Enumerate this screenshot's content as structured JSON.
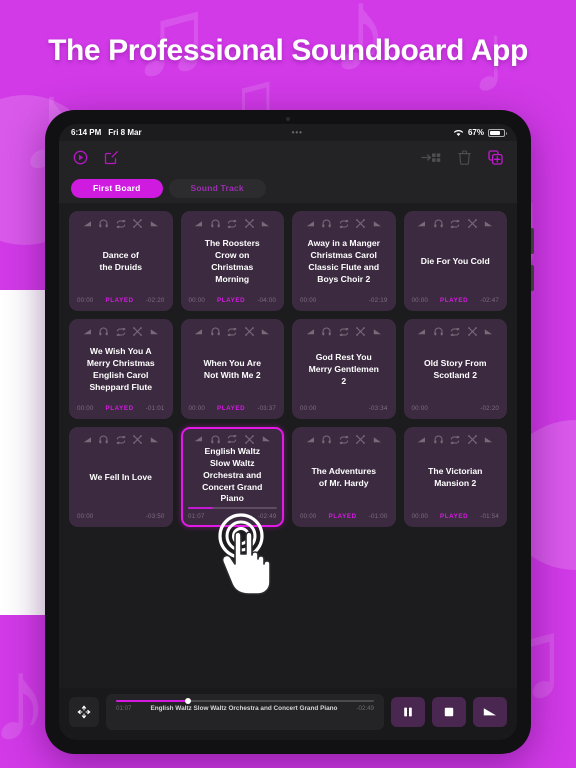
{
  "headline": "The Professional Soundboard App",
  "status_bar": {
    "time": "6:14 PM",
    "date": "Fri 8 Mar",
    "center_dots": "•••",
    "battery_percent": "67%",
    "wifi_icon": "wifi-icon",
    "battery_icon": "battery-icon"
  },
  "toolbar": {
    "left_icons": [
      {
        "name": "play-circle-icon"
      },
      {
        "name": "edit-square-icon"
      }
    ],
    "right_icons": [
      {
        "name": "move-to-grid-icon"
      },
      {
        "name": "trash-icon"
      },
      {
        "name": "duplicate-add-icon"
      }
    ]
  },
  "tabs": [
    {
      "label": "First Board",
      "active": true
    },
    {
      "label": "Sound Track",
      "active": false
    }
  ],
  "card_icons": [
    "fade-in-icon",
    "headphones-icon",
    "loop-icon",
    "effects-icon",
    "fade-out-icon"
  ],
  "cards": [
    {
      "title": "Dance of\nthe Druids",
      "elapsed": "00:00",
      "status": "PLAYED",
      "remaining": "-02:20",
      "selected": false,
      "progress": 0
    },
    {
      "title": "The Roosters\nCrow on\nChristmas\nMorning",
      "elapsed": "00:00",
      "status": "PLAYED",
      "remaining": "-04:00",
      "selected": false,
      "progress": 0
    },
    {
      "title": "Away in a Manger\nChristmas Carol\nClassic Flute and\nBoys Choir 2",
      "elapsed": "00:00",
      "status": "",
      "remaining": "-02:19",
      "selected": false,
      "progress": 0
    },
    {
      "title": "Die For You Cold",
      "elapsed": "00:00",
      "status": "PLAYED",
      "remaining": "-02:47",
      "selected": false,
      "progress": 0
    },
    {
      "title": "We Wish You A\nMerry Christmas\nEnglish Carol\nSheppard Flute",
      "elapsed": "00:00",
      "status": "PLAYED",
      "remaining": "-01:01",
      "selected": false,
      "progress": 0
    },
    {
      "title": "When You Are\nNot With Me 2",
      "elapsed": "00:00",
      "status": "PLAYED",
      "remaining": "-03:37",
      "selected": false,
      "progress": 0
    },
    {
      "title": "God Rest You\nMerry Gentlemen\n2",
      "elapsed": "00:00",
      "status": "",
      "remaining": "-03:34",
      "selected": false,
      "progress": 0
    },
    {
      "title": "Old Story From\nScotland 2",
      "elapsed": "00:00",
      "status": "",
      "remaining": "-02:20",
      "selected": false,
      "progress": 0
    },
    {
      "title": "We Fell In Love",
      "elapsed": "00:00",
      "status": "",
      "remaining": "-03:50",
      "selected": false,
      "progress": 0
    },
    {
      "title": "English Waltz\nSlow Waltz\nOrchestra and\nConcert Grand\nPiano",
      "elapsed": "01:07",
      "status": "",
      "remaining": "-02:49",
      "selected": true,
      "progress": 28
    },
    {
      "title": "The Adventures\nof Mr. Hardy",
      "elapsed": "00:00",
      "status": "PLAYED",
      "remaining": "-01:00",
      "selected": false,
      "progress": 0
    },
    {
      "title": "The Victorian\nMansion 2",
      "elapsed": "00:00",
      "status": "PLAYED",
      "remaining": "-01:54",
      "selected": false,
      "progress": 0
    }
  ],
  "player": {
    "move_icon": "move-resize-icon",
    "elapsed": "01:07",
    "now_playing": "English Waltz  Slow Waltz  Orchestra and Concert Grand Piano",
    "remaining": "-02:49",
    "progress_percent": 28,
    "controls": [
      {
        "name": "pause-button",
        "icon": "pause-icon"
      },
      {
        "name": "stop-button",
        "icon": "stop-icon"
      },
      {
        "name": "fade-out-button",
        "icon": "fade-out-icon"
      }
    ]
  },
  "cursor": {
    "name": "tap-hand-cursor"
  },
  "colors": {
    "brand_magenta": "#d23ae8",
    "accent": "#cf1ae0",
    "card_bg": "#3c2b40",
    "screen_bg": "#1c1c1e"
  }
}
